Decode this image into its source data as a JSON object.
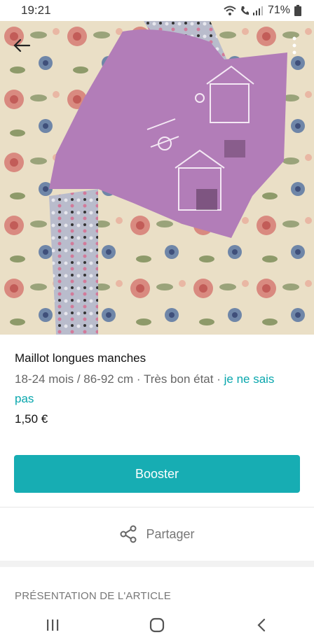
{
  "status_bar": {
    "time": "19:21",
    "battery": "71%"
  },
  "icons": {
    "back": "arrow-left-icon",
    "more": "more-vertical-icon",
    "share": "share-icon",
    "wifi": "wifi-icon",
    "signal": "signal-icon",
    "battery": "battery-icon",
    "nav_recents": "recent-apps-icon",
    "nav_home": "home-icon",
    "nav_back": "back-chevron-icon"
  },
  "item": {
    "title": "Maillot longues manches",
    "size": "18-24 mois / 86-92 cm",
    "separator": " · ",
    "condition": "Très bon état",
    "brand_link": "je ne sais pas",
    "price": "1,50 €"
  },
  "actions": {
    "booster_label": "Booster",
    "share_label": "Partager"
  },
  "section": {
    "presentation_title": "PRÉSENTATION DE L'ARTICLE"
  },
  "colors": {
    "accent": "#17adb3",
    "link": "#09a7ad",
    "shirt": "#b27db8"
  }
}
